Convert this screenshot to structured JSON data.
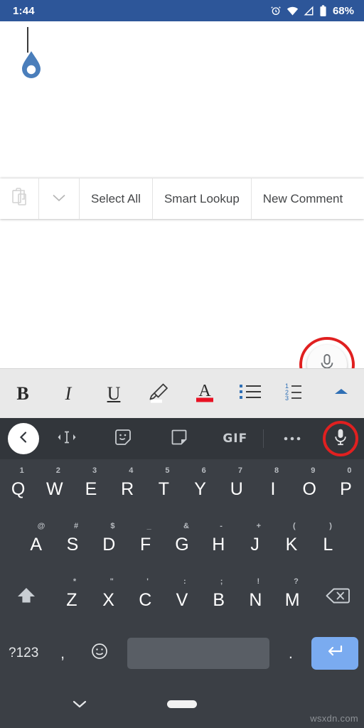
{
  "status_bar": {
    "time": "1:44",
    "battery_percent": "68%",
    "icons": [
      "alarm-icon",
      "wifi-icon",
      "signal-icon",
      "battery-icon"
    ],
    "background_color": "#2d5699"
  },
  "document": {
    "caret": "text-caret",
    "handle": "selection-handle",
    "handle_color": "#4a7ebb",
    "background_color": "#ffffff"
  },
  "context_menu": {
    "paste_icon": "paste-icon",
    "more_icon": "chevron-down-icon",
    "items": [
      {
        "label": "Select All"
      },
      {
        "label": "Smart Lookup"
      },
      {
        "label": "New Comment"
      }
    ]
  },
  "dictate_fab": {
    "icon": "microphone-icon",
    "highlight_color": "#e02020",
    "background_color": "#fbfbfb"
  },
  "format_toolbar": {
    "background_color": "#e9e9e9",
    "items": [
      {
        "name": "bold-button",
        "label": "B"
      },
      {
        "name": "italic-button",
        "label": "I"
      },
      {
        "name": "underline-button",
        "label": "U"
      },
      {
        "name": "highlight-button",
        "label": "",
        "icon": "highlighter-icon"
      },
      {
        "name": "font-color-button",
        "label": "A",
        "icon": "font-color-icon",
        "color": "#e81123"
      },
      {
        "name": "bullet-list-button",
        "label": "",
        "icon": "bullet-list-icon"
      },
      {
        "name": "numbered-list-button",
        "label": "",
        "icon": "numbered-list-icon"
      },
      {
        "name": "expand-button",
        "label": "",
        "icon": "chevron-up-icon"
      }
    ],
    "accent_color": "#2f6fb5"
  },
  "keyboard_toolbar": {
    "background_color": "#32363b",
    "back_icon": "chevron-left-icon",
    "tools": [
      {
        "name": "text-edit-icon",
        "label": ""
      },
      {
        "name": "sticker-icon",
        "label": ""
      },
      {
        "name": "translate-icon",
        "label": ""
      },
      {
        "name": "gif-button",
        "label": "GIF"
      },
      {
        "name": "overflow-menu-icon",
        "label": ""
      }
    ],
    "mic": {
      "name": "microphone-icon",
      "highlight_color": "#e02020"
    }
  },
  "keyboard": {
    "background_color": "#3b3f45",
    "row1": [
      {
        "letter": "Q",
        "sup": "1"
      },
      {
        "letter": "W",
        "sup": "2"
      },
      {
        "letter": "E",
        "sup": "3"
      },
      {
        "letter": "R",
        "sup": "4"
      },
      {
        "letter": "T",
        "sup": "5"
      },
      {
        "letter": "Y",
        "sup": "6"
      },
      {
        "letter": "U",
        "sup": "7"
      },
      {
        "letter": "I",
        "sup": "8"
      },
      {
        "letter": "O",
        "sup": "9"
      },
      {
        "letter": "P",
        "sup": "0"
      }
    ],
    "row2": [
      {
        "letter": "A",
        "sup": "@"
      },
      {
        "letter": "S",
        "sup": "#"
      },
      {
        "letter": "D",
        "sup": "$"
      },
      {
        "letter": "F",
        "sup": "_"
      },
      {
        "letter": "G",
        "sup": "&"
      },
      {
        "letter": "H",
        "sup": "-"
      },
      {
        "letter": "J",
        "sup": "+"
      },
      {
        "letter": "K",
        "sup": "("
      },
      {
        "letter": "L",
        "sup": ")"
      }
    ],
    "row3": [
      {
        "letter": "Z",
        "sup": "*"
      },
      {
        "letter": "X",
        "sup": "\""
      },
      {
        "letter": "C",
        "sup": "'"
      },
      {
        "letter": "V",
        "sup": ":"
      },
      {
        "letter": "B",
        "sup": ";"
      },
      {
        "letter": "N",
        "sup": "!"
      },
      {
        "letter": "M",
        "sup": "?"
      }
    ],
    "shift_icon": "shift-icon",
    "backspace_icon": "backspace-icon",
    "row4": {
      "symbols_label": "?123",
      "comma_label": ",",
      "emoji_icon": "emoji-icon",
      "space_label": "",
      "period_label": ".",
      "enter_icon": "enter-icon",
      "enter_color": "#7aabf0"
    }
  },
  "nav_bar": {
    "hide_keyboard_icon": "chevron-down-icon",
    "home_indicator": "home-pill",
    "background_color": "#3b3f45"
  },
  "watermark": {
    "text": "wsxdn.com"
  }
}
